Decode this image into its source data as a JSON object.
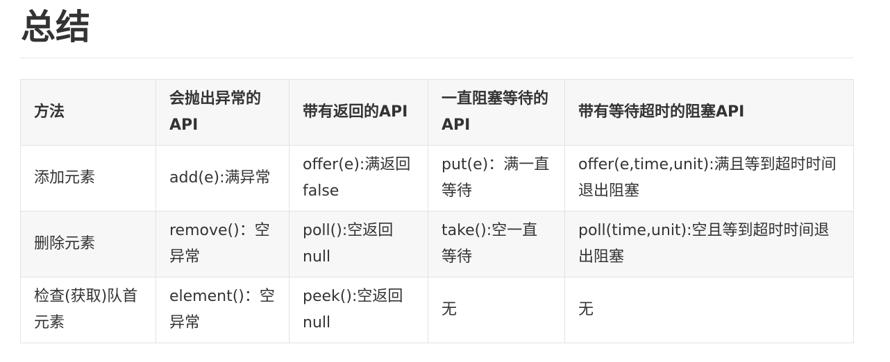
{
  "heading": "总结",
  "table": {
    "headers": [
      "方法",
      "会抛出异常的API",
      "带有返回的API",
      "一直阻塞等待的API",
      "带有等待超时的阻塞API"
    ],
    "rows": [
      [
        "添加元素",
        "add(e):满异常",
        "offer(e):满返回false",
        "put(e)：满一直等待",
        "offer(e,time,unit):满且等到超时时间退出阻塞"
      ],
      [
        "删除元素",
        "remove()：空异常",
        "poll():空返回null",
        "take():空一直等待",
        "poll(time,unit):空且等到超时时间退出阻塞"
      ],
      [
        "检查(获取)队首元素",
        "element()：空异常",
        "peek():空返回null",
        "无",
        "无"
      ]
    ]
  }
}
